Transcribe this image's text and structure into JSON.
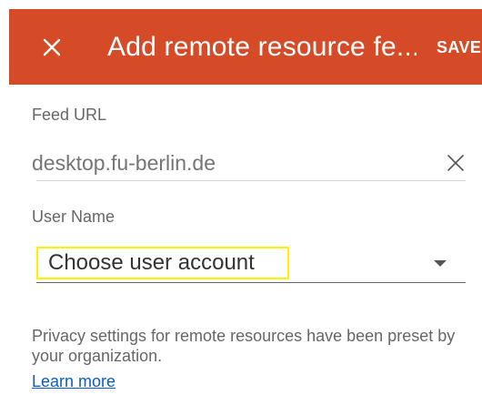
{
  "colors": {
    "app_bar": "#d64b27",
    "app_bar_text": "#ffffff",
    "label": "#666666",
    "placeholder": "#b8b8b8",
    "link": "#0a5cc8",
    "highlight_border": "#fff200"
  },
  "app_bar": {
    "close_icon": "close-icon",
    "title": "Add remote resource fe...",
    "save_label": "SAVE"
  },
  "form": {
    "feed_url": {
      "label": "Feed URL",
      "placeholder": "desktop.fu-berlin.de",
      "value": "",
      "clear_icon": "close-icon"
    },
    "user_name": {
      "label": "User Name",
      "selected": "Choose user account",
      "arrow_icon": "dropdown-arrow-icon"
    }
  },
  "privacy": {
    "text": "Privacy settings for remote resources have been preset by your organization.",
    "link": "Learn more"
  }
}
